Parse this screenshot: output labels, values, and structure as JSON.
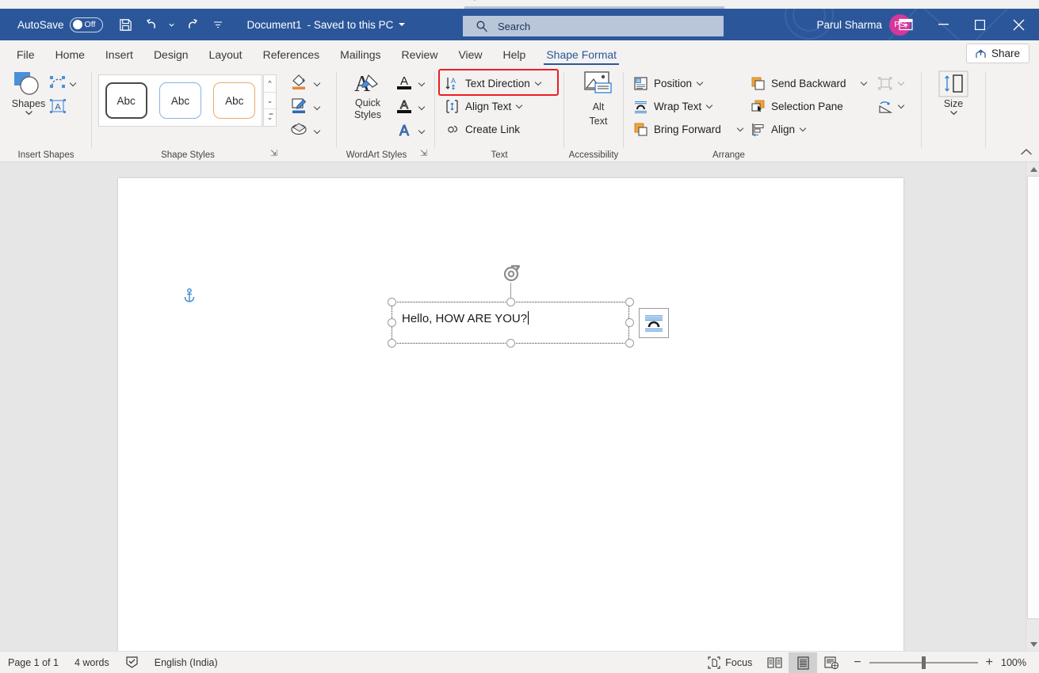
{
  "window": {
    "autosave_label": "AutoSave",
    "autosave_state": "Off",
    "document_title": "Document1",
    "save_location": "- Saved to this PC",
    "account_name": "Parul Sharma",
    "account_initials": "PS",
    "accent_color": "#2b579a",
    "avatar_color": "#d5379b",
    "quick_access": [
      {
        "name": "save-icon",
        "tooltip": "Save"
      },
      {
        "name": "undo-icon",
        "tooltip": "Undo"
      },
      {
        "name": "redo-icon",
        "tooltip": "Redo"
      },
      {
        "name": "customize-quick-access-toolbar-icon",
        "tooltip": "Customize Quick Access Toolbar"
      }
    ],
    "controls": {
      "ribbon_display_options": "Ribbon Display Options",
      "minimize": "Minimize",
      "maximize": "Restore Down",
      "close": "Close"
    }
  },
  "search": {
    "placeholder": "Search",
    "icon": "search-icon"
  },
  "tabs": [
    {
      "label": "File",
      "active": false
    },
    {
      "label": "Home",
      "active": false
    },
    {
      "label": "Insert",
      "active": false
    },
    {
      "label": "Design",
      "active": false
    },
    {
      "label": "Layout",
      "active": false
    },
    {
      "label": "References",
      "active": false
    },
    {
      "label": "Mailings",
      "active": false
    },
    {
      "label": "Review",
      "active": false
    },
    {
      "label": "View",
      "active": false
    },
    {
      "label": "Help",
      "active": false
    },
    {
      "label": "Shape Format",
      "active": true
    }
  ],
  "share_button": "Share",
  "ribbon": {
    "groups": {
      "insert_shapes": {
        "label": "Insert Shapes",
        "shapes_label": "Shapes",
        "edit_shape_label": "Edit Shape",
        "draw_text_box_label": "Draw Text Box"
      },
      "shape_styles": {
        "label": "Shape Styles",
        "gallery": [
          {
            "text": "Abc",
            "style": "dark-outline"
          },
          {
            "text": "Abc",
            "style": "blue-outline"
          },
          {
            "text": "Abc",
            "style": "orange-outline"
          }
        ],
        "shape_fill": "Shape Fill",
        "shape_outline": "Shape Outline",
        "shape_effects": "Shape Effects"
      },
      "wordart_styles": {
        "label": "WordArt Styles",
        "quick_styles": "Quick Styles",
        "text_fill": "Text Fill",
        "text_outline": "Text Outline",
        "text_effects": "Text Effects"
      },
      "text": {
        "label": "Text",
        "items": [
          {
            "label": "Text Direction",
            "icon": "text-direction-icon",
            "has_dropdown": true,
            "highlighted": true
          },
          {
            "label": "Align Text",
            "icon": "align-text-icon",
            "has_dropdown": true,
            "highlighted": false
          },
          {
            "label": "Create Link",
            "icon": "create-link-icon",
            "has_dropdown": false,
            "highlighted": false
          }
        ],
        "highlight_color": "#ee1c25"
      },
      "accessibility": {
        "label": "Accessibility",
        "alt_text": "Alt\nText",
        "alt_text_line1": "Alt",
        "alt_text_line2": "Text"
      },
      "arrange": {
        "label": "Arrange",
        "items": [
          {
            "label": "Position",
            "icon": "position-icon",
            "has_dropdown": true
          },
          {
            "label": "Wrap Text",
            "icon": "wrap-text-icon",
            "has_dropdown": true
          },
          {
            "label": "Bring Forward",
            "icon": "bring-forward-icon",
            "has_dropdown": true
          },
          {
            "label": "Send Backward",
            "icon": "send-backward-icon",
            "has_dropdown": true
          },
          {
            "label": "Selection Pane",
            "icon": "selection-pane-icon",
            "has_dropdown": false
          },
          {
            "label": "Align",
            "icon": "align-objects-icon",
            "has_dropdown": true
          }
        ],
        "group_objects": "Group",
        "rotate_objects": "Rotate"
      },
      "size": {
        "label": "Size",
        "size_label": "Size"
      }
    },
    "collapse_ribbon": "Collapse the Ribbon"
  },
  "document": {
    "textbox_text": "Hello, HOW ARE YOU?",
    "anchor_icon": "object-anchor-icon",
    "rotate_handle": "rotation-handle-icon",
    "layout_options_icon": "layout-options-icon"
  },
  "status_bar": {
    "page": "Page 1 of 1",
    "words": "4 words",
    "proofing_icon": "proofing-errors-icon",
    "language": "English (India)",
    "focus": "Focus",
    "views": [
      {
        "name": "read-mode-view-button",
        "active": false
      },
      {
        "name": "print-layout-view-button",
        "active": true
      },
      {
        "name": "web-layout-view-button",
        "active": false
      }
    ],
    "zoom_out": "−",
    "zoom_in": "+",
    "zoom_level": "100%"
  }
}
